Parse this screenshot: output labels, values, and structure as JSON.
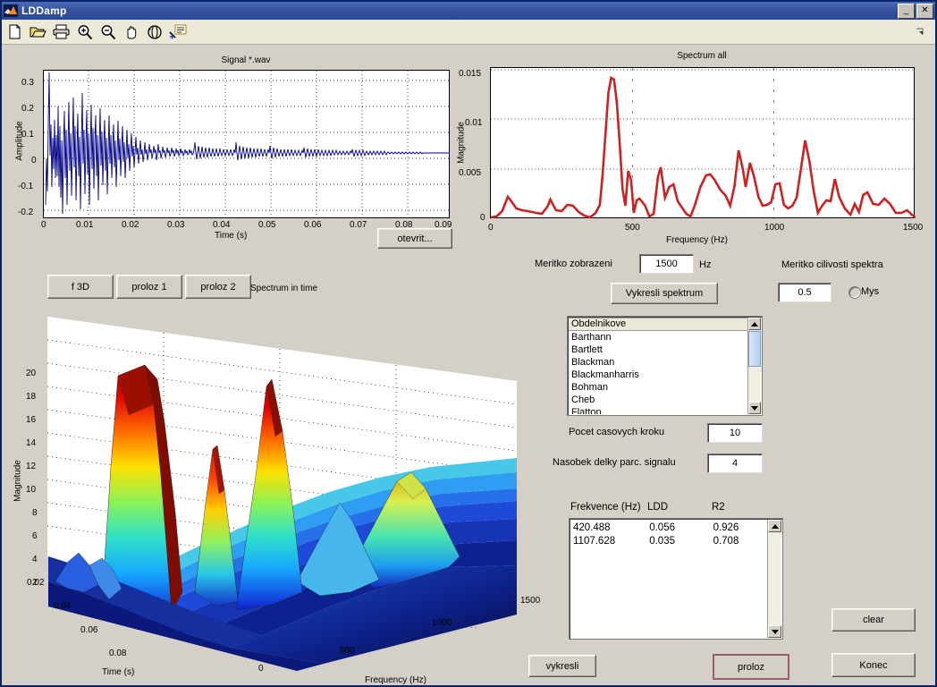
{
  "window": {
    "title": "LDDamp",
    "app_icon": "matlab-icon",
    "minimize_label": "_",
    "close_label": "✕"
  },
  "toolbar": {
    "items": [
      {
        "name": "new-figure-icon",
        "tooltip": "New Figure"
      },
      {
        "name": "open-file-icon",
        "tooltip": "Open File"
      },
      {
        "name": "print-icon",
        "tooltip": "Print Figure"
      },
      {
        "name": "zoom-in-icon",
        "tooltip": "Zoom In"
      },
      {
        "name": "zoom-out-icon",
        "tooltip": "Zoom Out"
      },
      {
        "name": "pan-hand-icon",
        "tooltip": "Pan"
      },
      {
        "name": "rotate-3d-icon",
        "tooltip": "Rotate 3D"
      },
      {
        "name": "insert-legend-icon",
        "tooltip": "Insert Legend"
      }
    ],
    "overflow_icon": "toolbar-overflow-arrow"
  },
  "signal_plot": {
    "title": "Signal *.wav",
    "ylabel": "Amplitude",
    "xlabel": "Time (s)",
    "yticks": [
      "0.3",
      "0.2",
      "0.1",
      "0",
      "-0.1",
      "-0.2"
    ],
    "xticks": [
      "0",
      "0.01",
      "0.02",
      "0.03",
      "0.04",
      "0.05",
      "0.06",
      "0.07",
      "0.08",
      "0.09"
    ],
    "line_color": "#00008b",
    "open_button": "otevrit..."
  },
  "spectrum_plot": {
    "title": "Spectrum all",
    "ylabel": "Magnitude",
    "xlabel": "Frequency (Hz)",
    "yticks": [
      "0.015",
      "0.01",
      "0.005",
      "0"
    ],
    "xticks": [
      "0",
      "500",
      "1000",
      "1500"
    ],
    "line_color": "#cc2222"
  },
  "surface_plot": {
    "title": "Spectrum in time",
    "zlabel": "Magnitude",
    "xlabel": "Time (s)",
    "ylabel": "Frequency (Hz)",
    "zticks": [
      "20",
      "18",
      "16",
      "14",
      "12",
      "10",
      "8",
      "6",
      "4",
      "2"
    ],
    "time_ticks": [
      "0.02",
      "0.04",
      "0.06",
      "0.08"
    ],
    "freq_ticks": [
      "0",
      "500",
      "1000",
      "1500"
    ],
    "colormap": "jet",
    "buttons": [
      {
        "name": "f-3d-button",
        "label": "f 3D"
      },
      {
        "name": "proloz-1-button",
        "label": "proloz 1"
      },
      {
        "name": "proloz-2-button",
        "label": "proloz 2"
      }
    ]
  },
  "controls": {
    "scale_label": "Meritko zobrazeni",
    "scale_value": "1500",
    "scale_unit": "Hz",
    "draw_spectrum_button": "Vykresli spektrum",
    "sensitivity_label": "Meritko cilivosti spektra",
    "sensitivity_value": "0.5",
    "mouse_radio_label": "Mys",
    "mouse_radio_checked": false,
    "steps_label": "Pocet casovych kroku",
    "steps_value": "10",
    "multiple_label": "Nasobek delky parc. signalu",
    "multiple_value": "4"
  },
  "window_list": {
    "selected": "Obdelnikove",
    "items": [
      "Obdelnikove",
      "Barthann",
      "Bartlett",
      "Blackman",
      "Blackmanharris",
      "Bohman",
      "Cheb",
      "Flattop"
    ]
  },
  "results": {
    "headers": [
      "Frekvence (Hz)",
      "LDD",
      "R2"
    ],
    "rows": [
      [
        "420.488",
        "0.056",
        "0.926"
      ],
      [
        "1107.628",
        "0.035",
        "0.708"
      ]
    ]
  },
  "actions": {
    "draw_button": "vykresli",
    "fit_button": "proloz",
    "clear_button": "clear",
    "quit_button": "Konec"
  },
  "chart_data": [
    {
      "type": "line",
      "title": "Signal *.wav",
      "xlabel": "Time (s)",
      "ylabel": "Amplitude",
      "xlim": [
        0,
        0.0965
      ],
      "ylim": [
        -0.235,
        0.345
      ],
      "grid": true,
      "series": [
        {
          "name": "signal",
          "color": "#00008b",
          "description": "damped oscillation decaying from +-0.23 to near 0"
        }
      ]
    },
    {
      "type": "line",
      "title": "Spectrum all",
      "xlabel": "Frequency (Hz)",
      "ylabel": "Magnitude",
      "xlim": [
        0,
        1500
      ],
      "ylim": [
        0,
        0.015
      ],
      "grid": true,
      "series": [
        {
          "name": "spectrum",
          "color": "#cc2222",
          "x": [
            0,
            20,
            40,
            60,
            70,
            90,
            110,
            130,
            160,
            180,
            200,
            210,
            230,
            250,
            270,
            290,
            310,
            330,
            350,
            370,
            385,
            395,
            405,
            415,
            425,
            435,
            445,
            455,
            465,
            475,
            485,
            495,
            505,
            515,
            525,
            545,
            560,
            575,
            590,
            600,
            615,
            630,
            645,
            660,
            675,
            690,
            705,
            720,
            740,
            760,
            775,
            790,
            810,
            830,
            845,
            860,
            875,
            890,
            900,
            915,
            930,
            945,
            960,
            975,
            990,
            1005,
            1020,
            1035,
            1050,
            1065,
            1080,
            1095,
            1110,
            1125,
            1140,
            1155,
            1170,
            1185,
            1200,
            1215,
            1230,
            1250,
            1270,
            1285,
            1300,
            1315,
            1330,
            1350,
            1370,
            1390,
            1410,
            1430,
            1450,
            1470,
            1490,
            1500
          ],
          "y": [
            0.0002,
            0.0003,
            0.0008,
            0.0022,
            0.0018,
            0.001,
            0.0009,
            0.0008,
            0.0006,
            0.0005,
            0.0012,
            0.0019,
            0.0009,
            0.0008,
            0.0014,
            0.0013,
            0.0007,
            0.0003,
            0.0001,
            0.0006,
            0.0013,
            0.0045,
            0.0085,
            0.0125,
            0.014,
            0.0138,
            0.0115,
            0.0075,
            0.003,
            0.0012,
            0.0048,
            0.0038,
            0.0006,
            0.0018,
            0.002,
            0.0013,
            0.0002,
            0.0004,
            0.004,
            0.005,
            0.002,
            0.003,
            0.0033,
            0.0016,
            0.001,
            0.0004,
            0.0002,
            0.0012,
            0.003,
            0.0042,
            0.0043,
            0.0038,
            0.0028,
            0.0022,
            0.0012,
            0.004,
            0.0068,
            0.005,
            0.0032,
            0.0056,
            0.004,
            0.0022,
            0.0012,
            0.0013,
            0.0015,
            0.0031,
            0.0032,
            0.0014,
            0.001,
            0.0012,
            0.002,
            0.005,
            0.0078,
            0.0058,
            0.0028,
            0.0006,
            0.0012,
            0.0017,
            0.0016,
            0.0038,
            0.0022,
            0.001,
            0.0004,
            0.0013,
            0.0007,
            0.0024,
            0.0027,
            0.0013,
            0.0012,
            0.0018,
            0.0015,
            0.0006,
            0.0006,
            0.0005,
            0.0009,
            0.0003
          ]
        }
      ]
    },
    {
      "type": "surface",
      "title": "Spectrum in time",
      "xlabel": "Time (s)",
      "ylabel": "Frequency (Hz)",
      "zlabel": "Magnitude",
      "xlim": [
        0.01,
        0.09
      ],
      "ylim": [
        0,
        1500
      ],
      "zlim": [
        0,
        21
      ],
      "colormap": "jet",
      "description": "Waterfall/surface of spectra over time; tall red peaks near 420 Hz at early times, secondary peaks near 900 and 1100 Hz"
    }
  ]
}
